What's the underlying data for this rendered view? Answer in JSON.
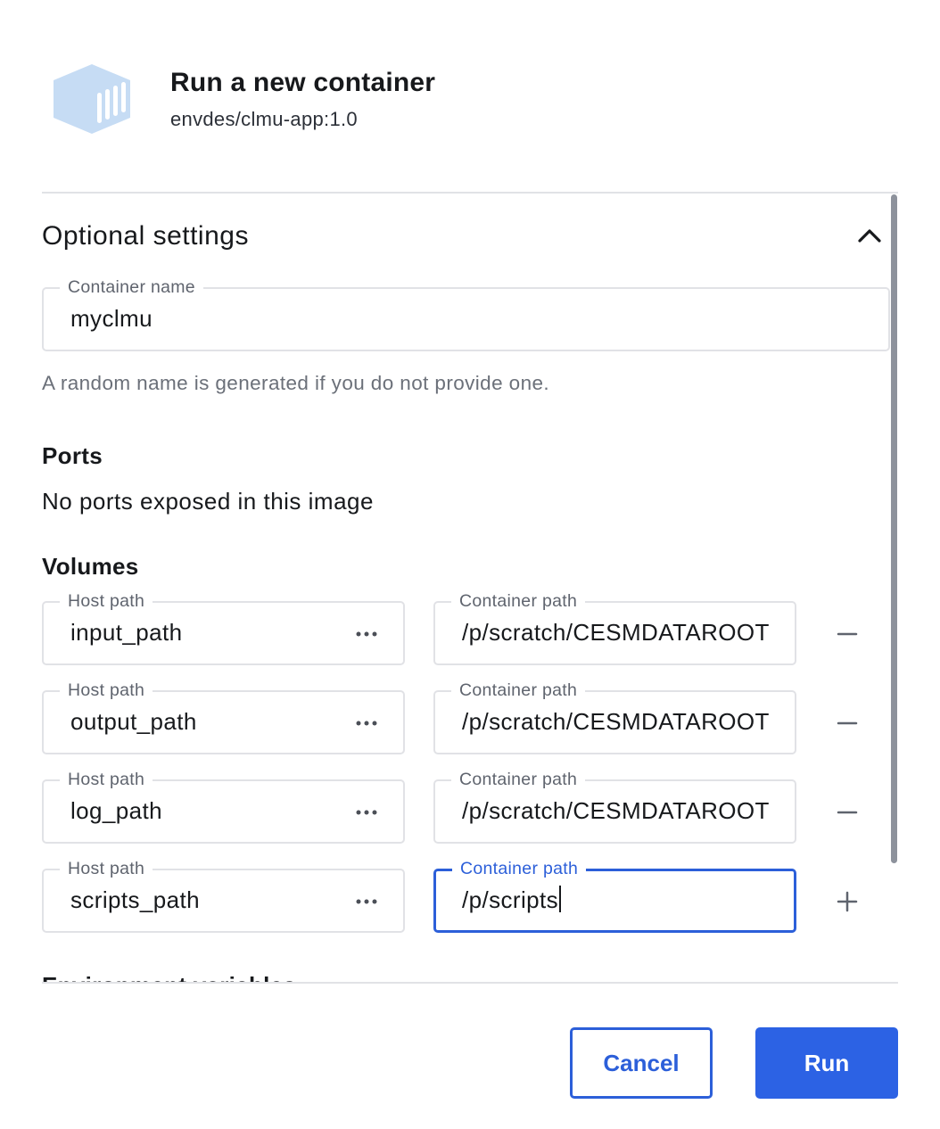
{
  "dialog": {
    "title": "Run a new container",
    "image_name": "envdes/clmu-app:1.0",
    "logo_icon": "container-box-icon"
  },
  "optional_settings": {
    "title": "Optional settings",
    "toggle_icon": "chevron-up-icon",
    "container_name": {
      "label": "Container name",
      "value": "myclmu"
    },
    "container_name_help": "A random name is generated if you do not provide one.",
    "ports": {
      "heading": "Ports",
      "message": "No ports exposed in this image"
    },
    "volumes": {
      "heading": "Volumes",
      "rows": [
        {
          "host_label": "Host path",
          "host_value": "input_path",
          "container_label": "Container path",
          "container_value": "/p/scratch/CESMDATAROOT",
          "action": "remove"
        },
        {
          "host_label": "Host path",
          "host_value": "output_path",
          "container_label": "Container path",
          "container_value": "/p/scratch/CESMDATAROOT",
          "action": "remove"
        },
        {
          "host_label": "Host path",
          "host_value": "log_path",
          "container_label": "Container path",
          "container_value": "/p/scratch/CESMDATAROOT",
          "action": "remove"
        },
        {
          "host_label": "Host path",
          "host_value": "scripts_path",
          "container_label": "Container path",
          "container_value": "/p/scripts",
          "action": "add"
        }
      ]
    },
    "env_heading": "Environment variables"
  },
  "footer": {
    "cancel_label": "Cancel",
    "run_label": "Run"
  },
  "colors": {
    "accent": "#2c62e4",
    "logo": "#c6dcf4"
  }
}
